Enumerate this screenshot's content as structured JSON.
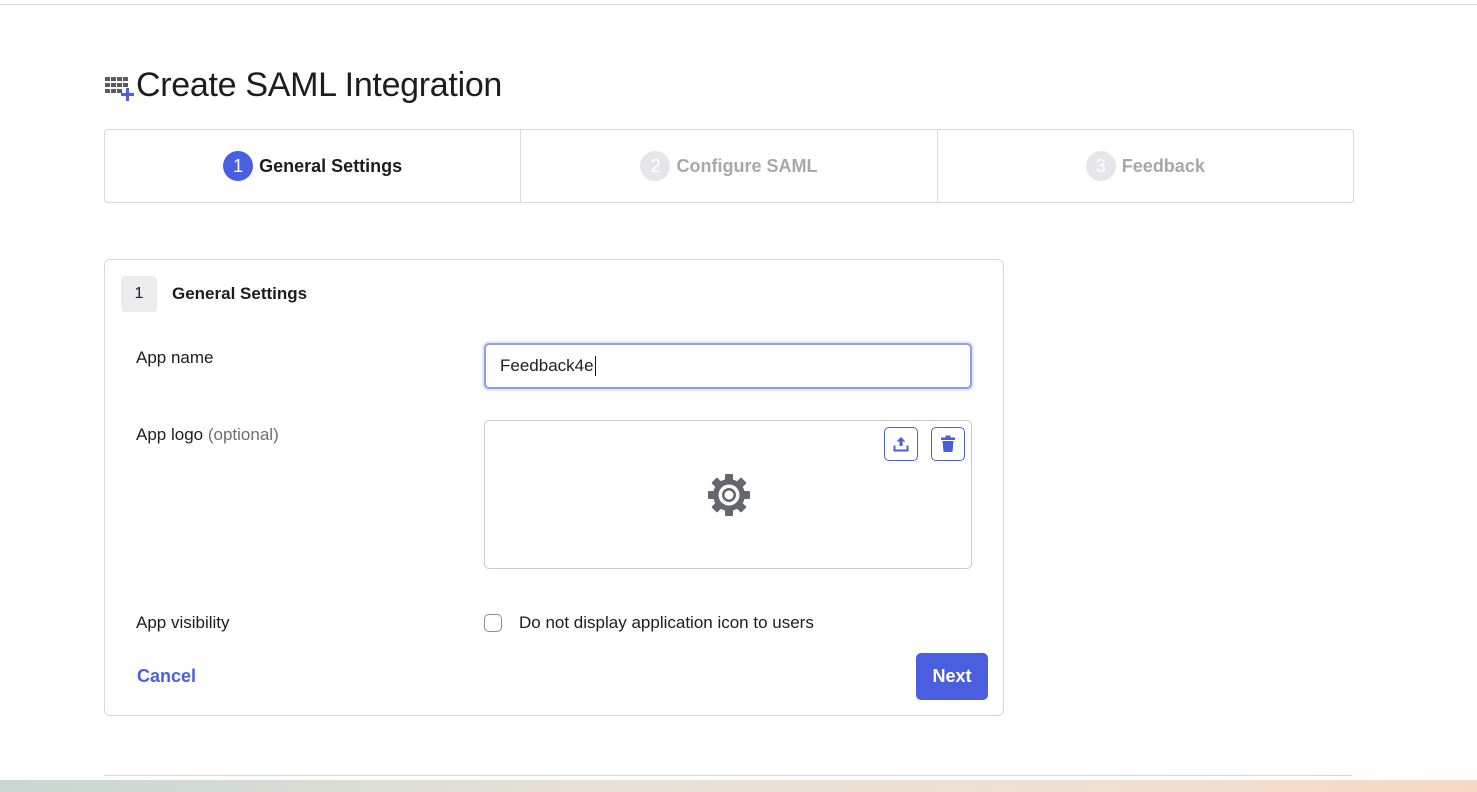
{
  "page": {
    "title": "Create SAML Integration",
    "header_icon": "add-app-grid-icon"
  },
  "stepper": {
    "steps": [
      {
        "number": "1",
        "label": "General Settings",
        "state": "active"
      },
      {
        "number": "2",
        "label": "Configure SAML",
        "state": "inactive"
      },
      {
        "number": "3",
        "label": "Feedback",
        "state": "inactive"
      }
    ]
  },
  "card": {
    "badge": "1",
    "title": "General Settings",
    "app_name": {
      "label": "App name",
      "value": "Feedback4e"
    },
    "app_logo": {
      "label": "App logo",
      "optional": "(optional)",
      "upload_icon": "upload-icon",
      "delete_icon": "trash-icon",
      "placeholder_icon": "gear-icon"
    },
    "app_visibility": {
      "label": "App visibility",
      "checkbox_label": "Do not display application icon to users",
      "checked": false
    },
    "cancel_label": "Cancel",
    "next_label": "Next"
  },
  "colors": {
    "accent": "#4a5fe0",
    "border": "#d7d7dc",
    "inactive_text": "#a7a7ae"
  }
}
